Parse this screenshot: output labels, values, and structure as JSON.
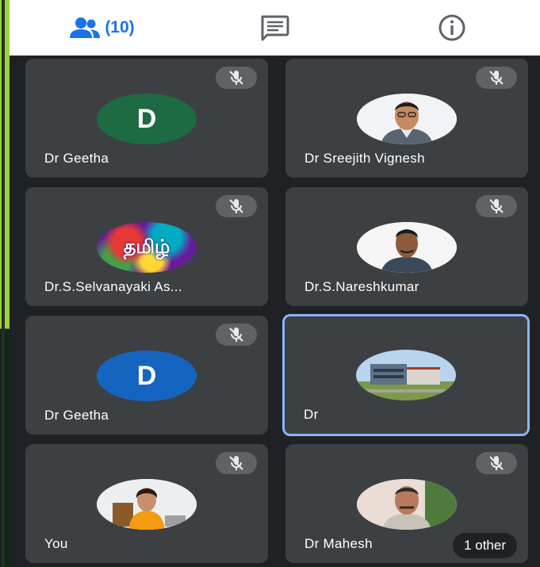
{
  "header": {
    "tabs": [
      {
        "id": "people",
        "icon": "people-icon",
        "count": "(10)",
        "active": true
      },
      {
        "id": "chat",
        "icon": "chat-icon"
      },
      {
        "id": "info",
        "icon": "info-icon"
      }
    ]
  },
  "colors": {
    "accent": "#1a73e8",
    "tile_bg": "#3c4043",
    "page_bg": "#202124",
    "active_border": "#8ab4f8",
    "avatar_green": "#1e6b43",
    "avatar_blue": "#1565c0"
  },
  "participants": [
    {
      "name": "Dr Geetha",
      "avatar_type": "letter",
      "letter": "D",
      "muted": true
    },
    {
      "name": "Dr Sreejith Vignesh",
      "avatar_type": "photo",
      "muted": true
    },
    {
      "name": "Dr.S.Selvanayaki As...",
      "avatar_type": "photo",
      "photo_text": "தமிழ்",
      "muted": true
    },
    {
      "name": "Dr.S.Nareshkumar",
      "avatar_type": "photo",
      "muted": true
    },
    {
      "name": "Dr Geetha",
      "avatar_type": "letter",
      "letter": "D",
      "muted": true
    },
    {
      "name": "Dr",
      "avatar_type": "photo",
      "muted": false,
      "speaking": true
    },
    {
      "name": "You",
      "avatar_type": "photo",
      "muted": true
    },
    {
      "name": "Dr Mahesh",
      "avatar_type": "photo",
      "muted": true,
      "overflow_label": "1 other"
    }
  ]
}
